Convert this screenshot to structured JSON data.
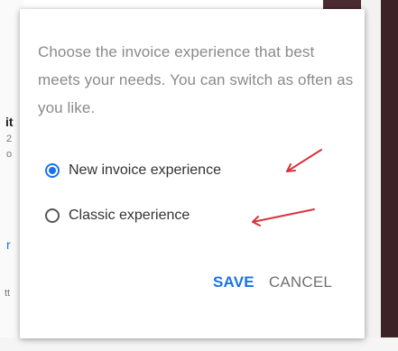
{
  "dialog": {
    "description": "Choose the invoice experience that best meets your needs. You can switch as often as you like.",
    "options": [
      {
        "label": "New invoice experience",
        "checked": true
      },
      {
        "label": "Classic experience",
        "checked": false
      }
    ],
    "save_label": "SAVE",
    "cancel_label": "CANCEL"
  },
  "background": {
    "fragments": [
      "it",
      "2",
      "o",
      "r",
      "tt"
    ]
  },
  "colors": {
    "accent": "#1a73e8",
    "annotation_arrow": "#d9343c",
    "description_text": "#8a8a8a"
  }
}
